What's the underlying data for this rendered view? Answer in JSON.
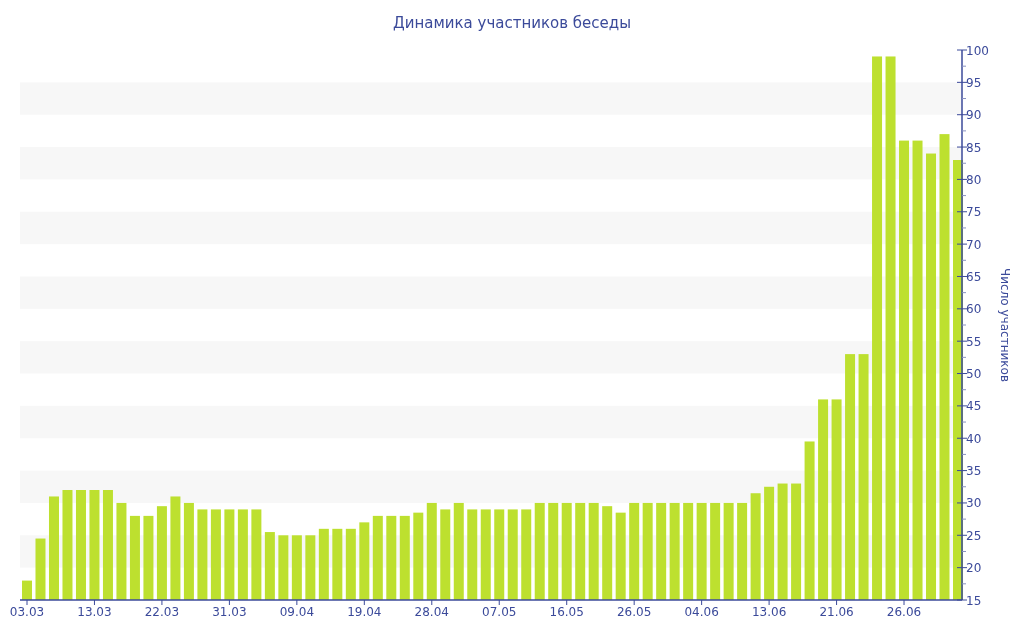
{
  "chart_data": {
    "type": "bar",
    "title": "Динамика участников беседы",
    "ylabel": "Число участников",
    "categories": [
      "03.03",
      null,
      null,
      null,
      null,
      "13.03",
      null,
      null,
      null,
      null,
      "22.03",
      null,
      null,
      null,
      null,
      "31.03",
      null,
      null,
      null,
      null,
      "09.04",
      null,
      null,
      null,
      null,
      "19.04",
      null,
      null,
      null,
      null,
      "28.04",
      null,
      null,
      null,
      null,
      "07.05",
      null,
      null,
      null,
      null,
      "16.05",
      null,
      null,
      null,
      null,
      "26.05",
      null,
      null,
      null,
      null,
      "04.06",
      null,
      null,
      null,
      null,
      "13.06",
      null,
      null,
      null,
      null,
      "21.06",
      null,
      null,
      null,
      null,
      "26.06",
      null,
      null,
      null,
      null
    ],
    "series": [
      {
        "color": "#bde02f",
        "values": [
          18,
          24.5,
          31,
          32,
          32,
          32,
          32,
          30,
          28,
          28,
          29.5,
          31,
          30,
          29,
          29,
          29,
          29,
          29,
          25.5,
          25,
          25,
          25,
          26,
          26,
          26,
          27,
          28,
          28,
          28,
          28.5,
          30,
          29,
          30,
          29,
          29,
          29,
          29,
          29,
          30,
          30,
          30,
          30,
          30,
          29.5,
          28.5,
          30,
          30,
          30,
          30,
          30,
          30,
          30,
          30,
          30,
          31.5,
          32.5,
          33,
          33,
          39.5,
          46,
          46,
          53,
          53,
          99,
          99,
          86,
          86,
          84,
          87,
          83
        ]
      }
    ],
    "ylim": [
      15,
      100
    ],
    "yticks": [
      15,
      20,
      25,
      30,
      35,
      40,
      45,
      50,
      55,
      60,
      65,
      70,
      75,
      80,
      85,
      90,
      95,
      100
    ]
  }
}
